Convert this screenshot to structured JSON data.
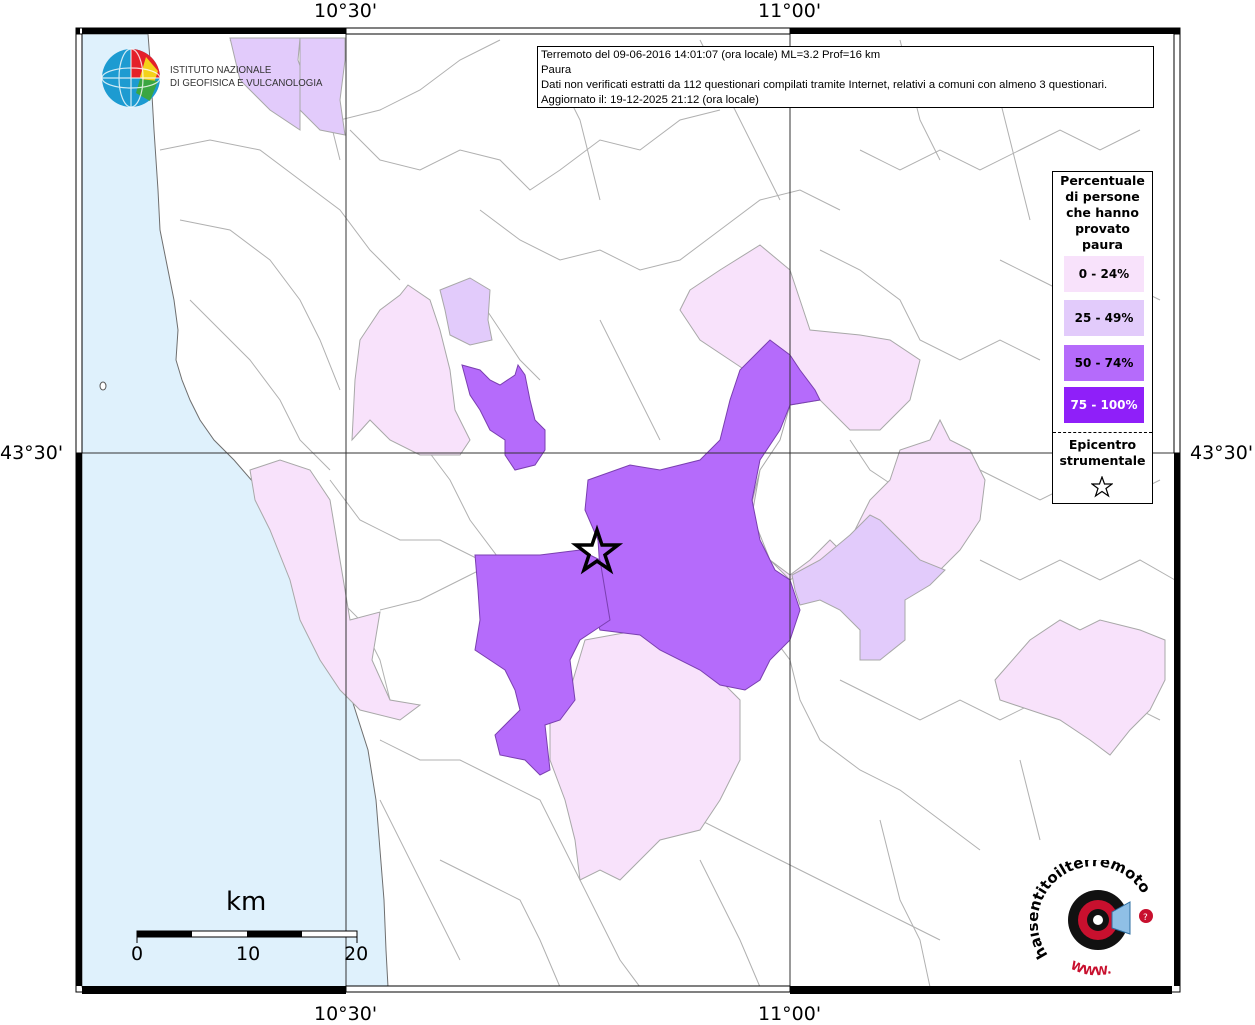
{
  "map": {
    "info": {
      "line1": "Terremoto del 09-06-2016 14:01:07 (ora locale) ML=3.2 Prof=16 km",
      "line2": "Paura",
      "line3": "Dati non verificati estratti da 112 questionari compilati tramite Internet, relativi a comuni con almeno 3 questionari.",
      "line4": "Aggiornato il: 19-12-2025 21:12 (ora locale)"
    },
    "coords": {
      "top_left": "10°30'",
      "top_right": "11°00'",
      "bottom_left": "10°30'",
      "bottom_right": "11°00'",
      "left_lat": "43°30'",
      "right_lat": "43°30'"
    },
    "logo": {
      "ingv_line1": "ISTITUTO NAZIONALE",
      "ingv_line2": "DI GEOFISICA E VULCANOLOGIA",
      "hst_text": "haisentitoilterremoto.it",
      "hst_www": "WWW."
    },
    "scale": {
      "title": "km",
      "labels": [
        "0",
        "10",
        "20"
      ]
    },
    "legend": {
      "title": "Percentuale di persone che hanno provato paura",
      "items": [
        {
          "label": "0 - 24%",
          "color": "#f8e2fb"
        },
        {
          "label": "25 - 49%",
          "color": "#e2cbfb"
        },
        {
          "label": "50 - 74%",
          "color": "#b56bfb"
        },
        {
          "label": "75 - 100%",
          "color": "#8f1ff9"
        }
      ],
      "epicenter_label": "Epicentro strumentale"
    },
    "colors": {
      "sea": "#dff1fc",
      "land": "#ffffff",
      "border": "#a8a8a8"
    }
  }
}
